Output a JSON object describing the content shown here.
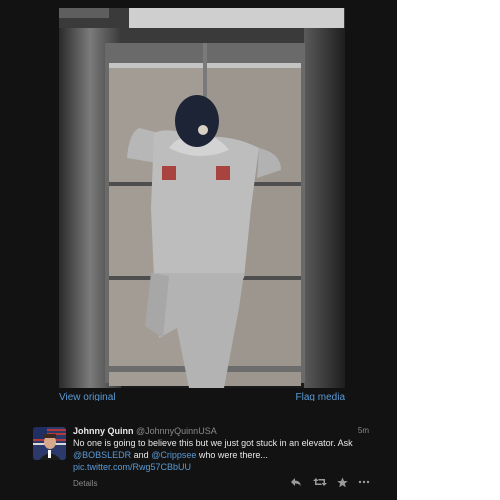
{
  "media": {
    "view_original": "View original",
    "flag_media": "Flag media"
  },
  "tweet": {
    "name": "Johnny Quinn",
    "handle": "@JohnnyQuinnUSA",
    "time": "5m",
    "text_part1": "No one is going to believe this but we just got stuck in an elevator. Ask ",
    "mention1": "@BOBSLEDR",
    "text_part2": " and ",
    "mention2": "@Crippsee",
    "text_part3": " who were there...",
    "link": "pic.twitter.com/Rwg57CBbUU",
    "details": "Details"
  },
  "actions": {
    "reply_icon": "reply-icon",
    "retweet_icon": "retweet-icon",
    "favorite_icon": "favorite-icon",
    "more_icon": "more-icon"
  },
  "colors": {
    "background": "#121212",
    "link": "#5b9bd5",
    "text": "#e8e8e8",
    "muted": "#8a8a8a"
  }
}
